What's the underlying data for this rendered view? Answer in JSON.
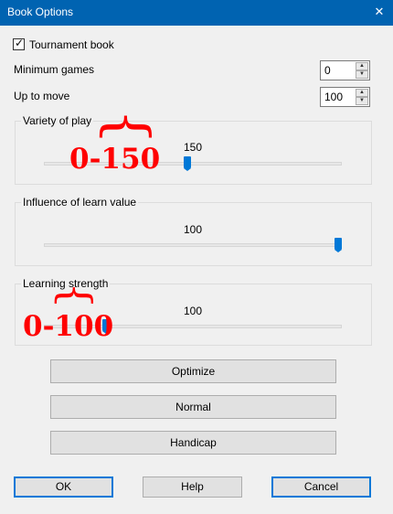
{
  "window": {
    "title": "Book Options",
    "close_glyph": "✕"
  },
  "tournament_book": {
    "label": "Tournament book",
    "checked": true
  },
  "minimum_games": {
    "label": "Minimum games",
    "value": "0"
  },
  "up_to_move": {
    "label": "Up to move",
    "value": "100"
  },
  "variety": {
    "label": "Variety of play",
    "value": "150",
    "annotation": "0-150",
    "brace": "}",
    "level": 0.48
  },
  "influence": {
    "label": "Influence of learn value",
    "value": "100",
    "level": 1.0
  },
  "learning": {
    "label": "Learning strength",
    "value": "100",
    "annotation": "0-100",
    "brace": "}",
    "level": 0.2
  },
  "buttons": {
    "optimize": "Optimize",
    "normal": "Normal",
    "handicap": "Handicap"
  },
  "footer": {
    "ok": "OK",
    "help": "Help",
    "cancel": "Cancel"
  },
  "colors": {
    "accent": "#0078d7",
    "annotation": "#ff0000",
    "titlebar": "#0063b1"
  }
}
